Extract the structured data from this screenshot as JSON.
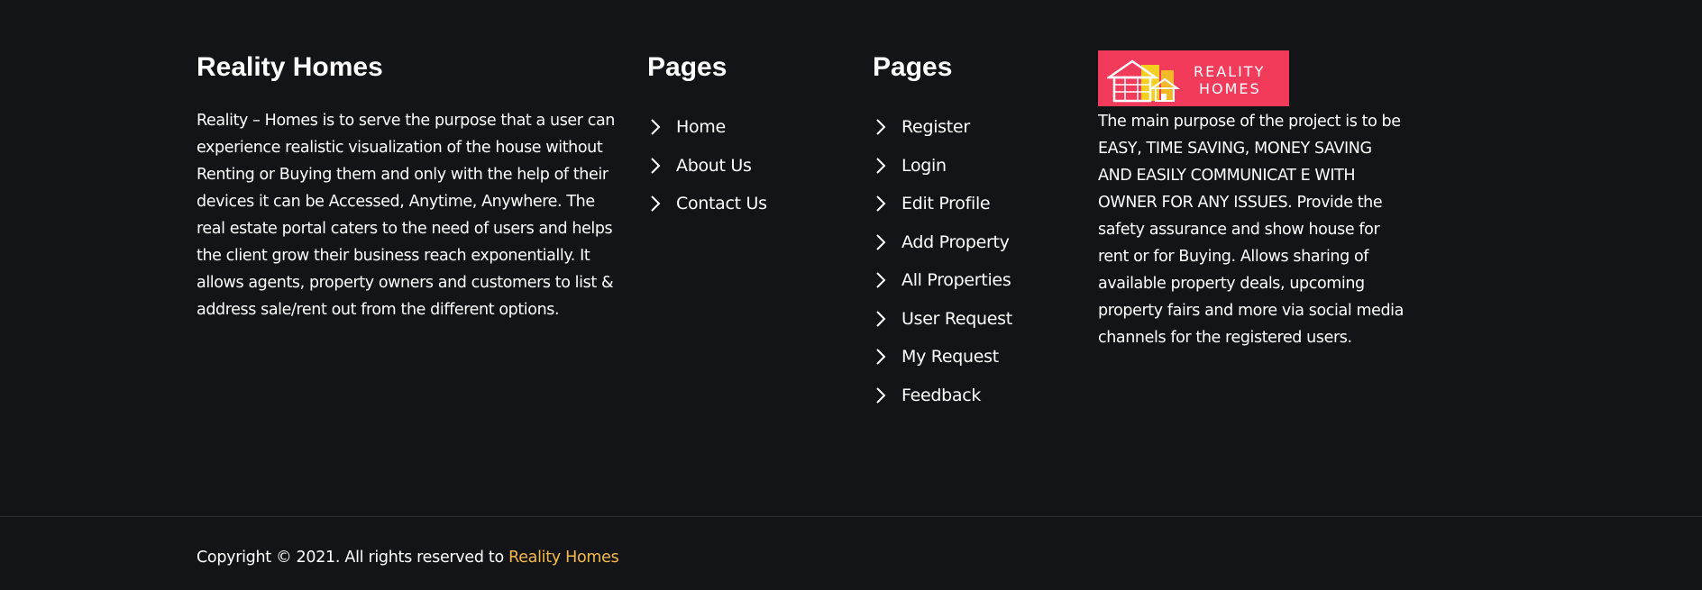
{
  "about": {
    "title": "Reality Homes",
    "text": "Reality – Homes is to serve the purpose that a user can experience realistic visualization of the house without Renting or Buying them and only with the help of their devices it can be Accessed, Anytime, Anywhere. The real estate portal caters to the need of users and helps the client grow their business reach exponentially. It allows agents, property owners and customers to list & address sale/rent out from the different options."
  },
  "pages1": {
    "title": "Pages",
    "links": [
      "Home",
      "About Us",
      "Contact Us"
    ]
  },
  "pages2": {
    "title": "Pages",
    "links": [
      "Register",
      "Login",
      "Edit Profile",
      "Add Property",
      "All Properties",
      "User Request",
      "My Request",
      "Feedback"
    ]
  },
  "brand": {
    "logo_line1": "REALITY",
    "logo_line2": "HOMES",
    "text": "The main purpose of the project is to be EASY, TIME SAVING, MONEY SAVING AND EASILY COMMUNICAT E WITH OWNER FOR ANY ISSUES. Provide the safety assurance and show house for rent or for Buying. Allows sharing of available property deals, upcoming property fairs and more via social media channels for the registered users."
  },
  "footer": {
    "copyright_prefix": "Copyright © 2021. All rights reserved to ",
    "copyright_link": "Reality Homes"
  },
  "colors": {
    "background": "#131417",
    "accent": "#f5b94a",
    "logo_bg": "#f23a5a"
  },
  "icons": {
    "link_bullet": "chevron-right-icon"
  }
}
